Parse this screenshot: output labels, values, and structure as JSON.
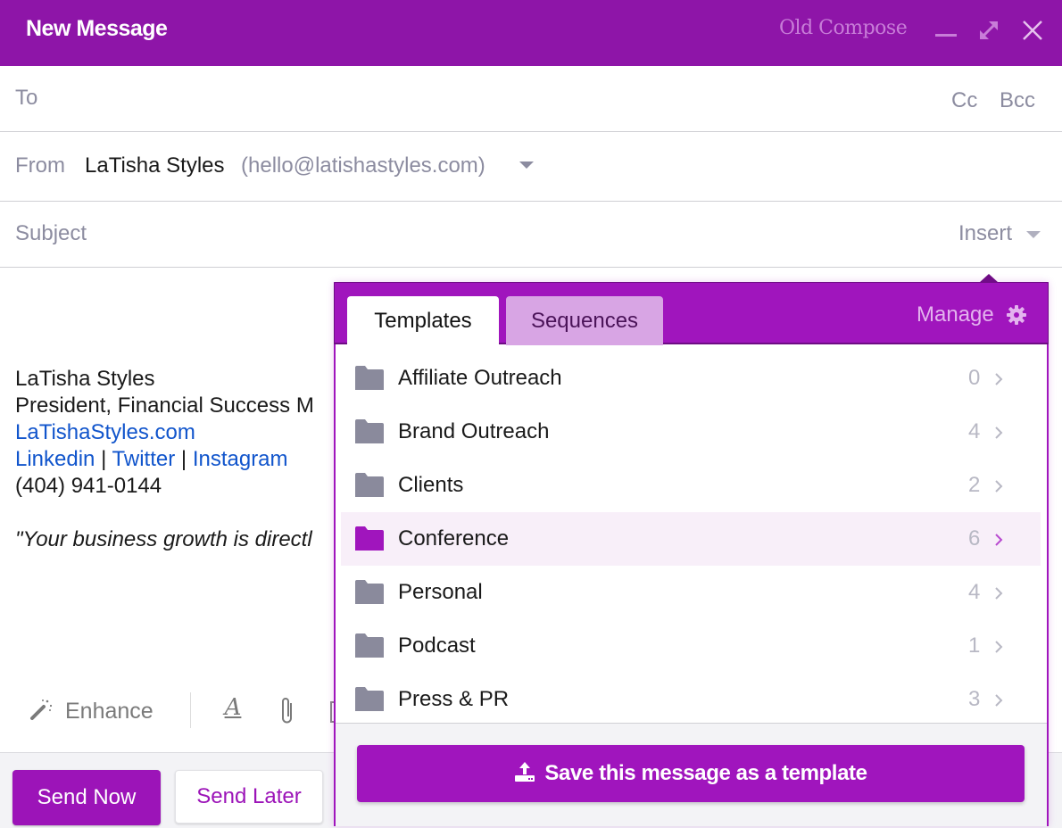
{
  "header": {
    "title": "New Message",
    "old_compose": "Old Compose",
    "icons": [
      "minimize-icon",
      "expand-icon",
      "close-icon"
    ]
  },
  "fields": {
    "to_label": "To",
    "cc_label": "Cc",
    "bcc_label": "Bcc",
    "from_label": "From",
    "from_name": "LaTisha Styles",
    "from_email": "(hello@latishastyles.com)",
    "subject_label": "Subject",
    "subject_value": "",
    "insert_label": "Insert"
  },
  "body": {
    "signature_name": "LaTisha Styles",
    "signature_title": "President, Financial Success M",
    "website": "LaTishaStyles.com",
    "links": [
      "Linkedin",
      "Twitter",
      "Instagram"
    ],
    "separator": " | ",
    "phone": "(404) 941-0144",
    "quote": "\"Your business growth is directl"
  },
  "toolbar": {
    "enhance_label": "Enhance",
    "font_icon_glyph": "A"
  },
  "footer": {
    "send_now": "Send Now",
    "send_later": "Send Later"
  },
  "popup": {
    "tabs": [
      {
        "label": "Templates",
        "active": true
      },
      {
        "label": "Sequences",
        "active": false
      }
    ],
    "manage_label": "Manage",
    "folders": [
      {
        "name": "Affiliate Outreach",
        "count": "0",
        "active": false
      },
      {
        "name": "Brand Outreach",
        "count": "4",
        "active": false
      },
      {
        "name": "Clients",
        "count": "2",
        "active": false
      },
      {
        "name": "Conference",
        "count": "6",
        "active": true
      },
      {
        "name": "Personal",
        "count": "4",
        "active": false
      },
      {
        "name": "Podcast",
        "count": "1",
        "active": false
      },
      {
        "name": "Press & PR",
        "count": "3",
        "active": false
      }
    ],
    "save_template_label": "Save this message as a template"
  },
  "colors": {
    "header_bg": "#8e15a8",
    "accent": "#a015bd",
    "folder_gray": "#8a8a9c",
    "folder_active": "#a015bd",
    "link_blue": "#1155cc",
    "muted_text": "#8c8ca0"
  }
}
